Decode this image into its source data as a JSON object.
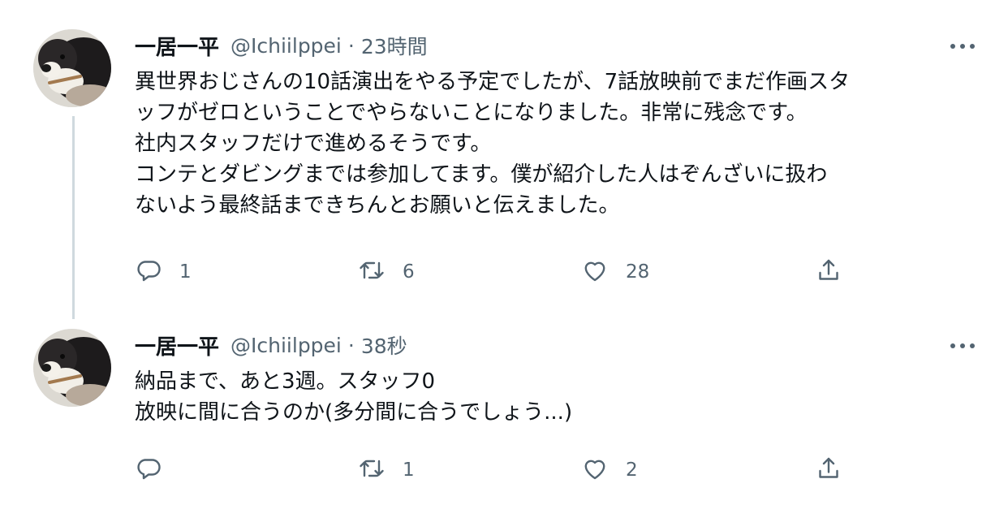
{
  "tweets": [
    {
      "author_name": "一居一平",
      "handle": "@Ichiilppei",
      "separator": "·",
      "time": "23時間",
      "avatar_icon": "dog-avatar-icon",
      "body_lines": [
        "異世界おじさんの10話演出をやる予定でしたが、7話放映前でまだ作画スタ",
        "ッフがゼロということでやらないことになりました。非常に残念です。",
        "社内スタッフだけで進めるそうです。",
        "コンテとダビングまでは参加してます。僕が紹介した人はぞんざいに扱わ",
        "ないよう最終話まできちんとお願いと伝えました。"
      ],
      "replies": "1",
      "retweets": "6",
      "likes": "28"
    },
    {
      "author_name": "一居一平",
      "handle": "@Ichiilppei",
      "separator": "·",
      "time": "38秒",
      "avatar_icon": "dog-avatar-icon",
      "body_lines": [
        "納品まで、あと3週。スタッフ0",
        "放映に間に合うのか(多分間に合うでしょう...)"
      ],
      "replies": "",
      "retweets": "1",
      "likes": "2"
    }
  ],
  "icons": {
    "more": "more-horizontal-icon",
    "reply": "reply-bubble-icon",
    "retweet": "retweet-arrows-icon",
    "like": "heart-icon",
    "share": "share-upload-icon"
  },
  "colors": {
    "text_primary": "#0f1419",
    "text_secondary": "#536471",
    "thread_line": "#cfd9de",
    "background": "#ffffff"
  }
}
